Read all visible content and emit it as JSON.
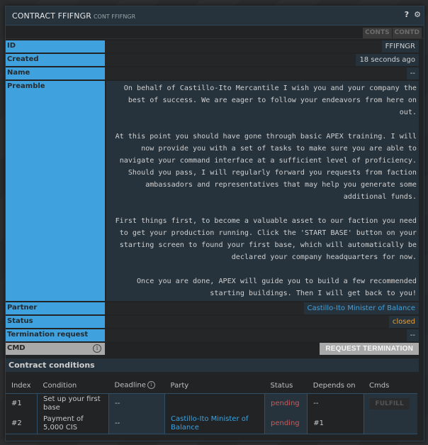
{
  "window": {
    "title": "CONTRACT FFIFNGR",
    "subtitle": "CONT FFIFNGR",
    "icons": [
      "help-icon",
      "gear-icon"
    ],
    "help_glyph": "?",
    "gear_glyph": "⚙"
  },
  "buffer_buttons": [
    "CONTS",
    "CONTD"
  ],
  "fields": {
    "id": {
      "label": "ID",
      "value": "FFIFNGR"
    },
    "created": {
      "label": "Created",
      "value": "18 seconds ago"
    },
    "name": {
      "label": "Name",
      "value": "--"
    },
    "preamble": {
      "label": "Preamble",
      "value": "On behalf of Castillo-Ito Mercantile I wish you and your company the best of success. We are eager to follow your endeavors from here on out.\n\nAt this point you should have gone through basic APEX training. I will now provide you with a set of tasks to make sure you are able to navigate your command interface at a sufficient level of proficiency. Should you pass, I will regularly forward you requests from faction ambassadors and representatives that may help you generate some additional funds.\n\nFirst things first, to become a valuable asset to our faction you need to get your production running. Click the 'START BASE' button on your starting screen to found your first base, which will automatically be declared your company headquarters for now.\n\nOnce you are done, APEX will guide you to build a few recommended starting buildings. Then I will get back to you!"
    },
    "partner": {
      "label": "Partner",
      "value": "Castillo-Ito Minister of Balance"
    },
    "status": {
      "label": "Status",
      "value": "closed"
    },
    "termination_request": {
      "label": "Termination request",
      "value": "--"
    },
    "cmd": {
      "label": "CMD",
      "info_glyph": "i",
      "button": "REQUEST TERMINATION"
    }
  },
  "conditions": {
    "title": "Contract conditions",
    "headers": [
      "Index",
      "Condition",
      "Deadline",
      "Party",
      "Status",
      "Depends on",
      "Cmds"
    ],
    "deadline_info_glyph": "i",
    "rows": [
      {
        "index": "#1",
        "condition": "Set up your first base",
        "deadline": "--",
        "party": "",
        "status": "pending",
        "depends_on": "--",
        "cmd": "FULFILL"
      },
      {
        "index": "#2",
        "condition": "Payment of 5,000 CIS",
        "deadline": "--",
        "party": "Castillo-Ito Minister of Balance",
        "status": "pending",
        "depends_on": "#1",
        "cmd": ""
      }
    ]
  },
  "colors": {
    "label_bg": "#3fa2de",
    "value_bg": "#26333d",
    "link": "#3fa2de",
    "closed": "#e59f3f",
    "pending": "#d9534f"
  }
}
